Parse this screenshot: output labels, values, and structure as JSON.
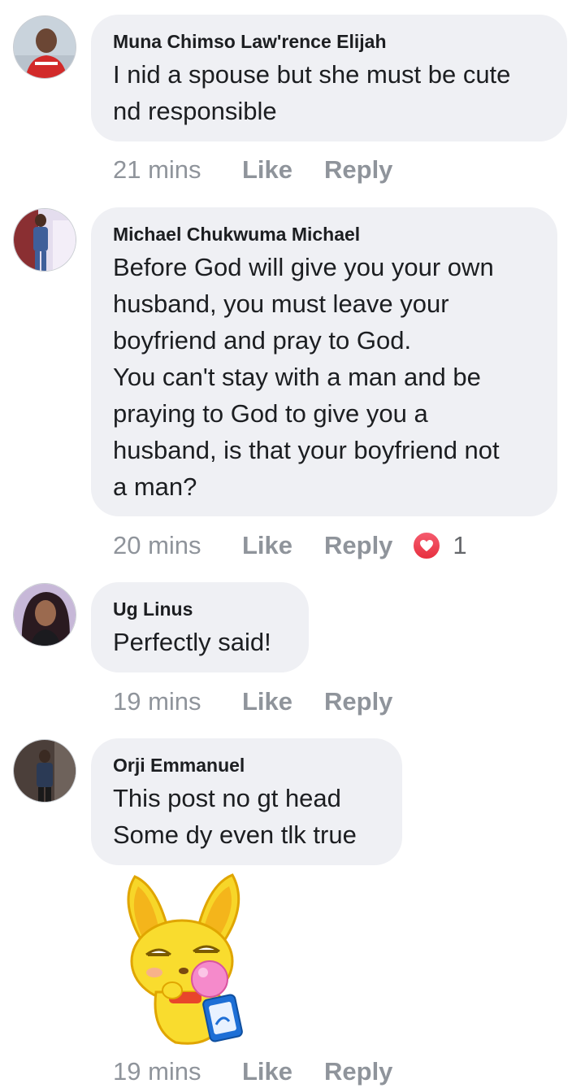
{
  "comments": [
    {
      "author": "Muna Chimso Law'rence Elijah",
      "text": "I nid a spouse but she must be cute\nnd responsible",
      "time": "21 mins",
      "like": "Like",
      "reply": "Reply"
    },
    {
      "author": "Michael Chukwuma Michael",
      "text": "Before God will give you your own\nhusband, you must leave your\nboyfriend and pray to God.\nYou can't stay with a man and be\npraying to God to give you a\nhusband, is that your boyfriend not\na man?",
      "time": "20 mins",
      "like": "Like",
      "reply": "Reply",
      "reaction_icon": "heart-icon",
      "reaction_count": "1"
    },
    {
      "author": "Ug Linus",
      "text": "Perfectly said!",
      "time": "19 mins",
      "like": "Like",
      "reply": "Reply"
    },
    {
      "author": "Orji Emmanuel",
      "text": "This post no gt head\nSome dy even tlk true",
      "time": "19 mins",
      "like": "Like",
      "reply": "Reply",
      "sticker": "yellow-bunny-bubblegum-sticker"
    }
  ],
  "colors": {
    "bubble": "#eff0f4",
    "meta_text": "#8f949b",
    "reaction_heart": "#e7303f"
  }
}
